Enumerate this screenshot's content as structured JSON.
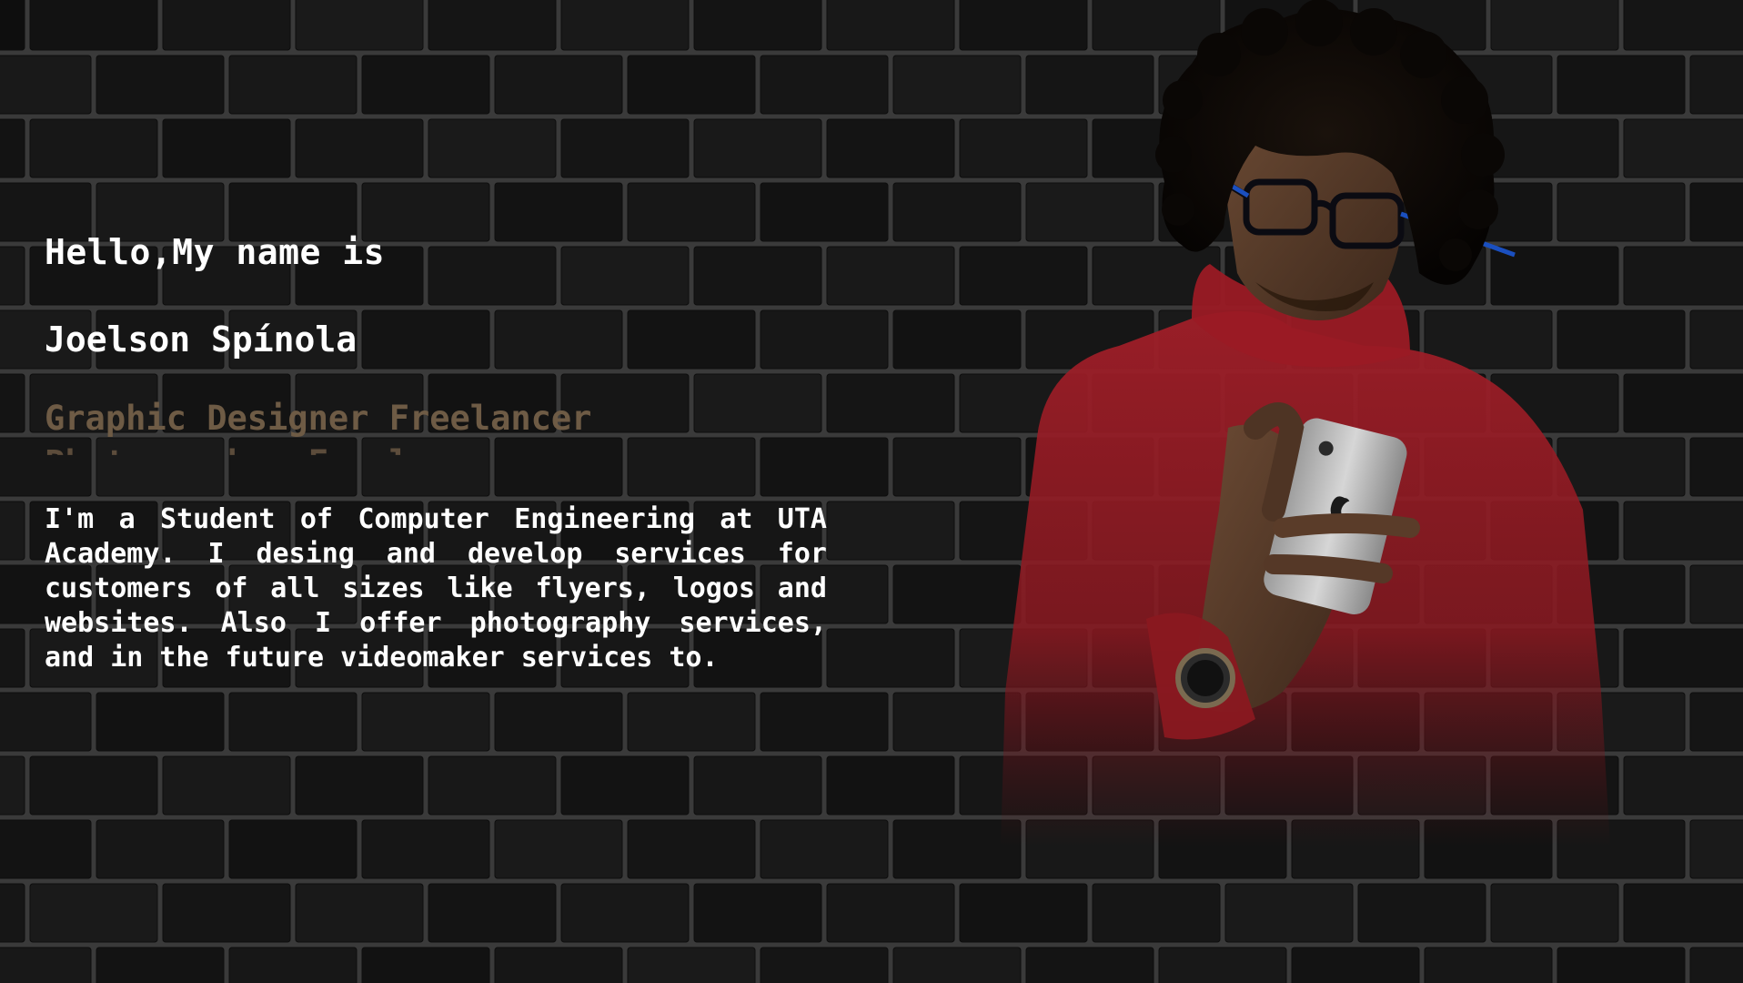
{
  "hero": {
    "greeting": "Hello,My name is",
    "name": "Joelson Spínola",
    "role": "Graphic Designer Freelancer",
    "role_next": "Photographer Freelancer",
    "bio": "I'm a Student of Computer Engineering at UTA Academy. I desing and develop services for customers of all sizes like flyers, logos and websites. Also I offer photography services, and in the future videomaker services to."
  },
  "colors": {
    "background": "#1b1b1b",
    "text": "#ffffff",
    "role_accent": "#6e5b45",
    "sweater": "#8e1a22"
  },
  "portrait": {
    "icon": "person-holding-phone-photo"
  }
}
